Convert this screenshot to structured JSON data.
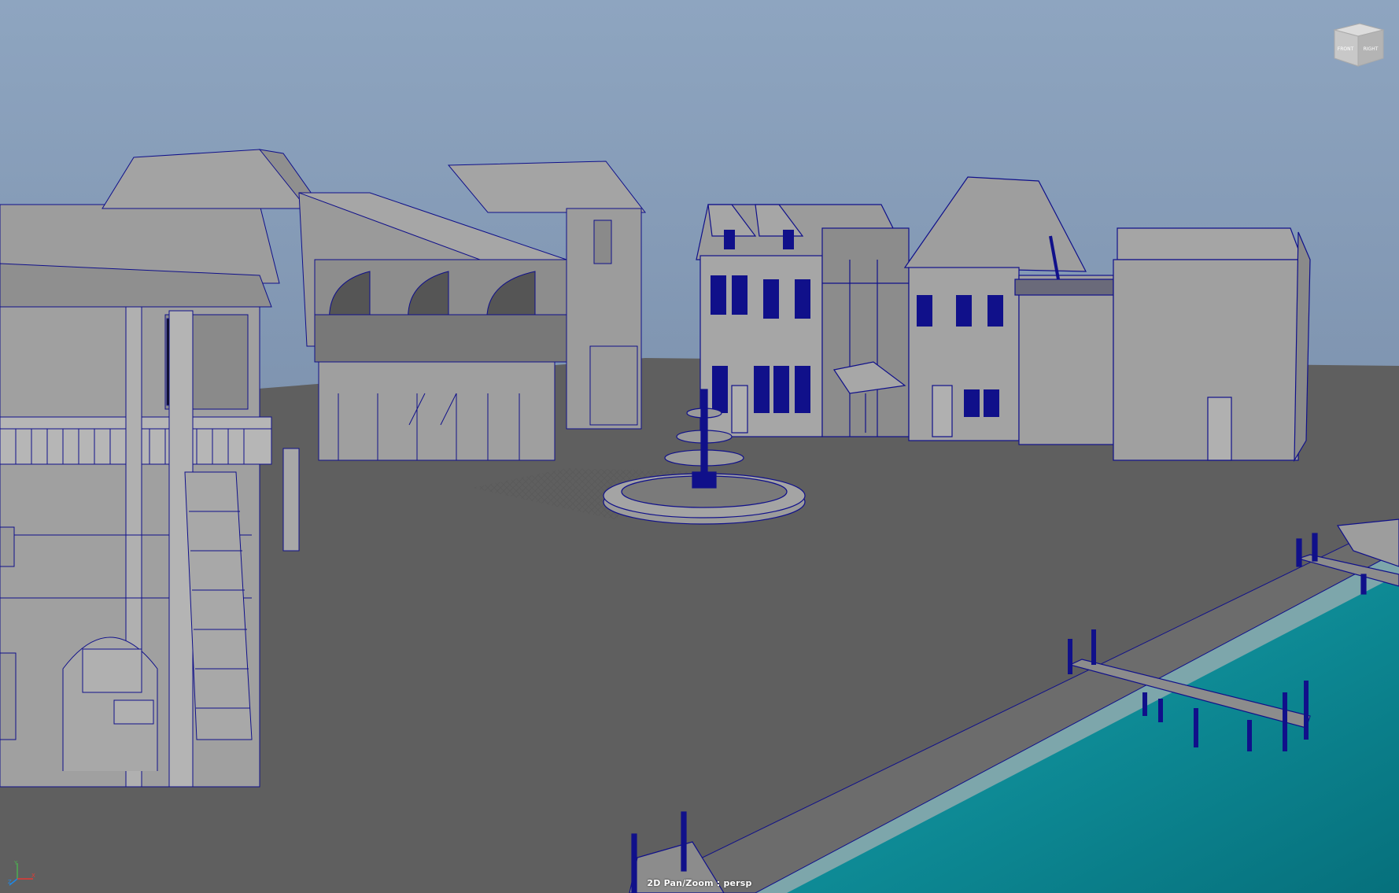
{
  "viewport": {
    "status": "2D Pan/Zoom : persp"
  },
  "viewcube": {
    "face_front": "FRONT",
    "face_right": "RIGHT"
  },
  "axis": {
    "x": "X",
    "y": "Y",
    "z": "Z"
  },
  "colors": {
    "sky_top": "#8aa2bd",
    "sky_bottom": "#6e84a3",
    "ground": "#5e5e5e",
    "wall": "#9a9a9a",
    "wire": "#10108a",
    "water": "#0a8a98"
  }
}
